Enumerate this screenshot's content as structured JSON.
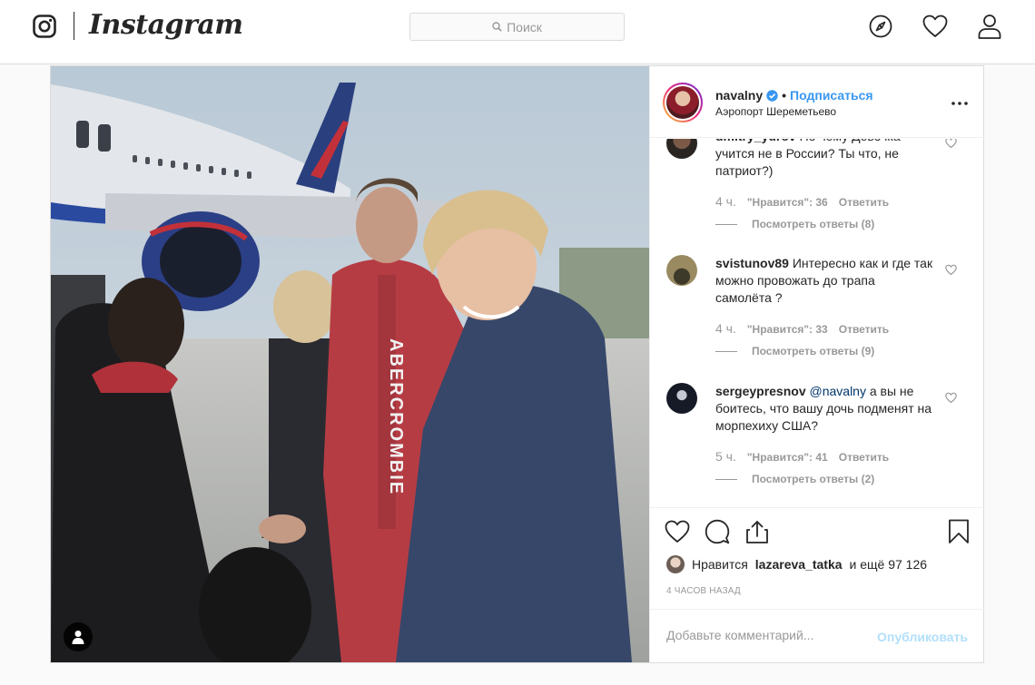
{
  "app": {
    "brand": "Instagram"
  },
  "search": {
    "placeholder": "Поиск"
  },
  "nav": {
    "icons": [
      "compass-icon",
      "heart-icon",
      "profile-icon"
    ]
  },
  "post": {
    "owner": "navalny",
    "follow_label": "Подписаться",
    "separator": "•",
    "location": "Аэропорт Шереметьево",
    "hoodie_text": "ABERCROMBIE"
  },
  "comments": [
    {
      "username": "dmitry_yurov",
      "text": "По чему Девочка учится не в России? Ты что, не патриот?)",
      "time": "4 ч.",
      "likes_label": "\"Нравится\": 36",
      "reply_label": "Ответить",
      "replies": "Посмотреть ответы (8)"
    },
    {
      "username": "svistunov89",
      "text": "Интересно как и где так можно провожать до трапа самолёта ?",
      "time": "4 ч.",
      "likes_label": "\"Нравится\": 33",
      "reply_label": "Ответить",
      "replies": "Посмотреть ответы (9)"
    },
    {
      "username": "sergeypresnov",
      "mention": "@navalny",
      "text": "а вы не боитесь, что вашу дочь подменят на морпехиху США?",
      "time": "5 ч.",
      "likes_label": "\"Нравится\": 41",
      "reply_label": "Ответить",
      "replies": "Посмотреть ответы (2)"
    }
  ],
  "likes": {
    "prefix": "Нравится",
    "user": "lazareva_tatka",
    "suffix": "и ещё 97 126"
  },
  "timestamp": "4 ЧАСОВ НАЗАД",
  "add_comment": {
    "placeholder": "Добавьте комментарий...",
    "publish_label": "Опубликовать"
  },
  "colors": {
    "accent": "#3897f0",
    "publish_disabled": "#b2dffc",
    "border": "#dbdbdb",
    "meta": "#999999"
  }
}
